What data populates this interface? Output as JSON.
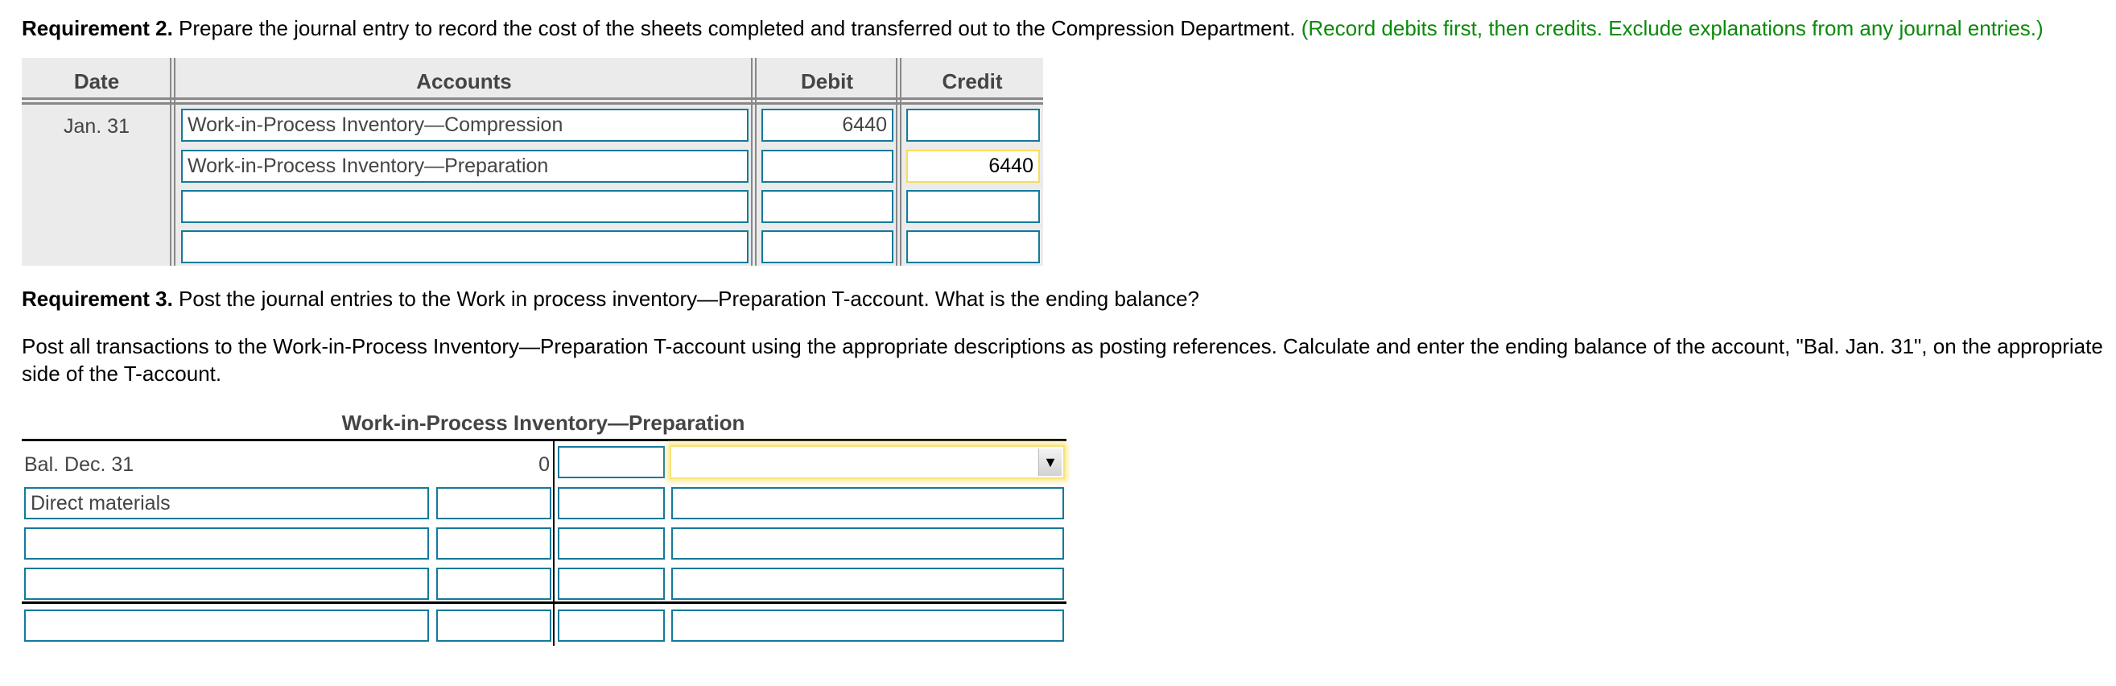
{
  "requirement2": {
    "label": "Requirement 2.",
    "text": " Prepare the journal entry to record the cost of the sheets completed and transferred out to the Compression Department.",
    "instruction": " (Record debits first, then credits. Exclude explanations from any journal entries.)"
  },
  "journal": {
    "headers": {
      "date": "Date",
      "accounts": "Accounts",
      "debit": "Debit",
      "credit": "Credit"
    },
    "date": "Jan. 31",
    "rows": [
      {
        "account": "Work-in-Process Inventory—Compression",
        "debit": "6440",
        "credit": ""
      },
      {
        "account": "Work-in-Process Inventory—Preparation",
        "debit": "",
        "credit": "6440"
      },
      {
        "account": "",
        "debit": "",
        "credit": ""
      },
      {
        "account": "",
        "debit": "",
        "credit": ""
      }
    ]
  },
  "requirement3": {
    "label": "Requirement 3.",
    "text": " Post the journal entries to the Work in process inventory—Preparation T-account. What is the ending balance?",
    "instructions": "Post all transactions to the Work-in-Process Inventory—Preparation T-account using the appropriate descriptions as posting references. Calculate and enter the ending balance of the account, \"Bal. Jan. 31\", on the appropriate side of the T-account."
  },
  "taccount": {
    "title": "Work-in-Process Inventory—Preparation",
    "opening": {
      "label": "Bal. Dec. 31",
      "value": "0"
    },
    "dropdown_value": "",
    "dropdown_icon": "triangle-down",
    "left_rows": [
      {
        "label": "Direct materials",
        "value": ""
      },
      {
        "label": "",
        "value": ""
      },
      {
        "label": "",
        "value": ""
      }
    ],
    "right_rows": [
      {
        "value": "",
        "label": ""
      },
      {
        "value": "",
        "label": ""
      },
      {
        "value": "",
        "label": ""
      }
    ],
    "balance_row": {
      "left_label": "",
      "left_value": "",
      "right_value": "",
      "right_label": ""
    }
  }
}
